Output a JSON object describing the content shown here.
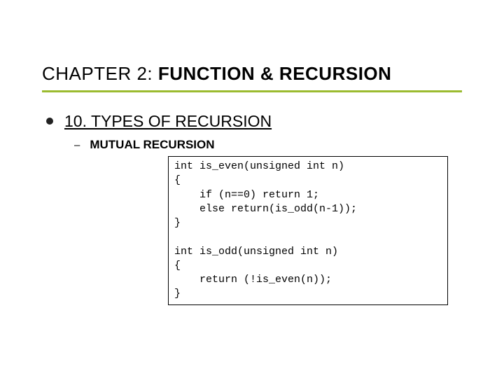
{
  "title_prefix": "CHAPTER 2: ",
  "title_bold": "FUNCTION & RECURSION",
  "heading": "10. TYPES OF RECURSION",
  "subheading": "MUTUAL RECURSION",
  "code": "int is_even(unsigned int n)\n{\n    if (n==0) return 1;\n    else return(is_odd(n-1));\n}\n\nint is_odd(unsigned int n)\n{\n    return (!is_even(n));\n}"
}
